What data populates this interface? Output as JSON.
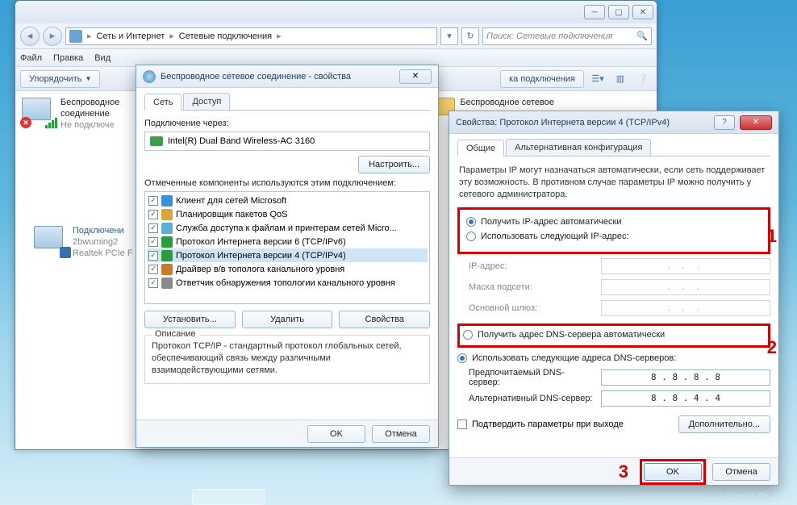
{
  "explorer": {
    "breadcrumb": {
      "p1": "Сеть и Интернет",
      "p2": "Сетевые подключения"
    },
    "search_placeholder": "Поиск: Сетевые подключения",
    "menu": {
      "file": "Файл",
      "edit": "Правка",
      "view": "Вид"
    },
    "toolbar": {
      "organize": "Упорядочить",
      "partial": "ка подключения"
    },
    "item2_folder": "Беспроводное сетевое"
  },
  "conns": {
    "wifi": {
      "t1": "Беспроводное",
      "t2": "соединение",
      "t3": "Не подключе"
    },
    "lan": {
      "t1": "Подключени",
      "t2": "2bwuming2",
      "t3": "Realtek PCIe F"
    }
  },
  "dlg1": {
    "title": "Беспроводное сетевое соединение - свойства",
    "tab_net": "Сеть",
    "tab_access": "Доступ",
    "conn_via": "Подключение через:",
    "adapter": "Intel(R) Dual Band Wireless-AC 3160",
    "configure": "Настроить...",
    "components_lbl": "Отмеченные компоненты используются этим подключением:",
    "c1": "Клиент для сетей Microsoft",
    "c2": "Планировщик пакетов QoS",
    "c3": "Служба доступа к файлам и принтерам сетей Micro...",
    "c4": "Протокол Интернета версии 6 (TCP/IPv6)",
    "c5": "Протокол Интернета версии 4 (TCP/IPv4)",
    "c6": "Драйвер в/в тополога канального уровня",
    "c7": "Ответчик обнаружения топологии канального уровня",
    "install": "Установить...",
    "remove": "Удалить",
    "props": "Свойства",
    "desc_t": "Описание",
    "desc": "Протокол TCP/IP - стандартный протокол глобальных сетей, обеспечивающий связь между различными взаимодействующими сетями.",
    "ok": "OK",
    "cancel": "Отмена"
  },
  "dlg2": {
    "title": "Свойства: Протокол Интернета версии 4 (TCP/IPv4)",
    "tab_general": "Общие",
    "tab_alt": "Альтернативная конфигурация",
    "info": "Параметры IP могут назначаться автоматически, если сеть поддерживает эту возможность. В противном случае параметры IP можно получить у сетевого администратора.",
    "ip_auto": "Получить IP-адрес автоматически",
    "ip_manual": "Использовать следующий IP-адрес:",
    "ip_lbl": "IP-адрес:",
    "mask_lbl": "Маска подсети:",
    "gw_lbl": "Основной шлюз:",
    "dns_auto": "Получить адрес DNS-сервера автоматически",
    "dns_manual": "Использовать следующие адреса DNS-серверов:",
    "dns1_lbl": "Предпочитаемый DNS-сервер:",
    "dns2_lbl": "Альтернативный DNS-сервер:",
    "dns1": "8 . 8 . 8 . 8",
    "dns2": "8 . 8 . 4 . 4",
    "confirm": "Подтвердить параметры при выходе",
    "advanced": "Дополнительно...",
    "ok": "OK",
    "cancel": "Отмена",
    "m1": "1",
    "m2": "2",
    "m3": "3"
  },
  "watermark": "User-Life.com"
}
